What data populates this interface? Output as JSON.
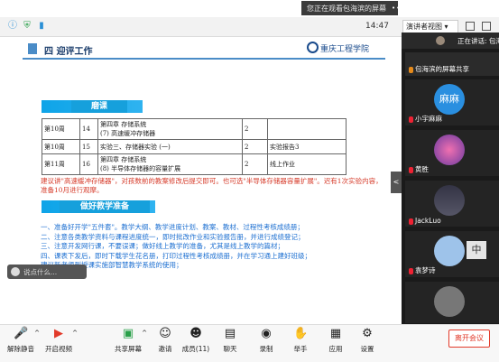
{
  "banner": {
    "text": "您正在观看包海滨的屏幕",
    "menu": "•••"
  },
  "topbar": {
    "time": "14:47",
    "view_label": "演讲者视图",
    "view_caret": "▾"
  },
  "slide": {
    "section_num": "四",
    "section_title": "迎评工作",
    "logo_text": "重庆工程学院",
    "sec1": "磨课",
    "sec2": "做好教学准备",
    "table": [
      [
        "第10周",
        "14",
        "第四章 存储系统\n(7) 高速缓冲存储器",
        "2",
        ""
      ],
      [
        "第10周",
        "15",
        "实验三、存储器实验 (一)",
        "2",
        "实验报告3"
      ],
      [
        "第11周",
        "16",
        "第四章 存储系统\n(8) 半导体存储器的容量扩展",
        "2",
        "线上作业"
      ]
    ],
    "red_note": "建议讲\"高速缓冲存储器\"，对孩数前的教案修改后提交即可。也可选\"半导体存储器容量扩展\"。迟有1次实验内容，准备10月进行观摩。",
    "blue_list": [
      "一、准备好开学\"五件套\"。教学大纲、教学进度计划、教案、教材、过程性考核成绩册；",
      "二、注意各类教学资料与课程进度统一，即时批改作业和实验报告册，并进行成绩登记；",
      "三、注意开发网行课，不要误课；做好线上教学的准备，尤其是线上教学的篇材；",
      "四、课表下发后，即时下载学生花名册，打印过程性考核成绩册，并在学习通上建好班级；",
      "建议新老师到授课实施部智慧教学系统的使用；"
    ],
    "chat_placeholder": "说点什么...",
    "handle": "<"
  },
  "panel": {
    "speaking": "正在讲话: 包海",
    "tiles": [
      {
        "name": "包海滨的屏幕共享",
        "avatar_text": "",
        "color": "#3a6fb0"
      },
      {
        "name": "小宇麻麻",
        "avatar_text": "麻麻",
        "color": "#2a8fe0"
      },
      {
        "name": "黄胜",
        "avatar_text": "",
        "color": "#c04a8a"
      },
      {
        "name": "JackLuo",
        "avatar_text": "",
        "color": "#4a5a70"
      },
      {
        "name": "袁梦诗",
        "avatar_text": "",
        "color": "#7aa6d8"
      },
      {
        "name": "",
        "avatar_text": "",
        "color": "#8a8a8a"
      }
    ],
    "ime": "中"
  },
  "toolbar": {
    "items": [
      {
        "label": "解除静音",
        "icon": "🎤"
      },
      {
        "label": "开启视频",
        "icon": "📷"
      },
      {
        "label": "共享屏幕",
        "icon": "🖥"
      },
      {
        "label": "邀请",
        "icon": "👤"
      },
      {
        "label": "成员(11)",
        "icon": "👥"
      },
      {
        "label": "聊天",
        "icon": "💬"
      },
      {
        "label": "录制",
        "icon": "⏺"
      },
      {
        "label": "举手",
        "icon": "✋"
      },
      {
        "label": "应用",
        "icon": "▦"
      },
      {
        "label": "设置",
        "icon": "⚙"
      }
    ],
    "leave": "离开会议"
  }
}
